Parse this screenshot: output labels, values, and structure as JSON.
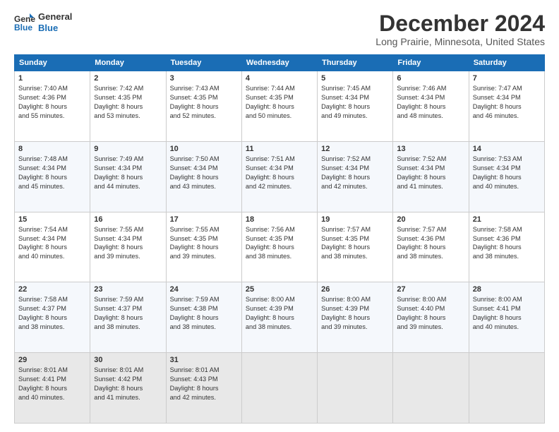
{
  "logo": {
    "line1": "General",
    "line2": "Blue"
  },
  "title": "December 2024",
  "subtitle": "Long Prairie, Minnesota, United States",
  "days_of_week": [
    "Sunday",
    "Monday",
    "Tuesday",
    "Wednesday",
    "Thursday",
    "Friday",
    "Saturday"
  ],
  "weeks": [
    [
      {
        "day": "1",
        "sunrise": "7:40 AM",
        "sunset": "4:36 PM",
        "daylight": "8 hours and 55 minutes."
      },
      {
        "day": "2",
        "sunrise": "7:42 AM",
        "sunset": "4:35 PM",
        "daylight": "8 hours and 53 minutes."
      },
      {
        "day": "3",
        "sunrise": "7:43 AM",
        "sunset": "4:35 PM",
        "daylight": "8 hours and 52 minutes."
      },
      {
        "day": "4",
        "sunrise": "7:44 AM",
        "sunset": "4:35 PM",
        "daylight": "8 hours and 50 minutes."
      },
      {
        "day": "5",
        "sunrise": "7:45 AM",
        "sunset": "4:34 PM",
        "daylight": "8 hours and 49 minutes."
      },
      {
        "day": "6",
        "sunrise": "7:46 AM",
        "sunset": "4:34 PM",
        "daylight": "8 hours and 48 minutes."
      },
      {
        "day": "7",
        "sunrise": "7:47 AM",
        "sunset": "4:34 PM",
        "daylight": "8 hours and 46 minutes."
      }
    ],
    [
      {
        "day": "8",
        "sunrise": "7:48 AM",
        "sunset": "4:34 PM",
        "daylight": "8 hours and 45 minutes."
      },
      {
        "day": "9",
        "sunrise": "7:49 AM",
        "sunset": "4:34 PM",
        "daylight": "8 hours and 44 minutes."
      },
      {
        "day": "10",
        "sunrise": "7:50 AM",
        "sunset": "4:34 PM",
        "daylight": "8 hours and 43 minutes."
      },
      {
        "day": "11",
        "sunrise": "7:51 AM",
        "sunset": "4:34 PM",
        "daylight": "8 hours and 42 minutes."
      },
      {
        "day": "12",
        "sunrise": "7:52 AM",
        "sunset": "4:34 PM",
        "daylight": "8 hours and 42 minutes."
      },
      {
        "day": "13",
        "sunrise": "7:52 AM",
        "sunset": "4:34 PM",
        "daylight": "8 hours and 41 minutes."
      },
      {
        "day": "14",
        "sunrise": "7:53 AM",
        "sunset": "4:34 PM",
        "daylight": "8 hours and 40 minutes."
      }
    ],
    [
      {
        "day": "15",
        "sunrise": "7:54 AM",
        "sunset": "4:34 PM",
        "daylight": "8 hours and 40 minutes."
      },
      {
        "day": "16",
        "sunrise": "7:55 AM",
        "sunset": "4:34 PM",
        "daylight": "8 hours and 39 minutes."
      },
      {
        "day": "17",
        "sunrise": "7:55 AM",
        "sunset": "4:35 PM",
        "daylight": "8 hours and 39 minutes."
      },
      {
        "day": "18",
        "sunrise": "7:56 AM",
        "sunset": "4:35 PM",
        "daylight": "8 hours and 38 minutes."
      },
      {
        "day": "19",
        "sunrise": "7:57 AM",
        "sunset": "4:35 PM",
        "daylight": "8 hours and 38 minutes."
      },
      {
        "day": "20",
        "sunrise": "7:57 AM",
        "sunset": "4:36 PM",
        "daylight": "8 hours and 38 minutes."
      },
      {
        "day": "21",
        "sunrise": "7:58 AM",
        "sunset": "4:36 PM",
        "daylight": "8 hours and 38 minutes."
      }
    ],
    [
      {
        "day": "22",
        "sunrise": "7:58 AM",
        "sunset": "4:37 PM",
        "daylight": "8 hours and 38 minutes."
      },
      {
        "day": "23",
        "sunrise": "7:59 AM",
        "sunset": "4:37 PM",
        "daylight": "8 hours and 38 minutes."
      },
      {
        "day": "24",
        "sunrise": "7:59 AM",
        "sunset": "4:38 PM",
        "daylight": "8 hours and 38 minutes."
      },
      {
        "day": "25",
        "sunrise": "8:00 AM",
        "sunset": "4:39 PM",
        "daylight": "8 hours and 38 minutes."
      },
      {
        "day": "26",
        "sunrise": "8:00 AM",
        "sunset": "4:39 PM",
        "daylight": "8 hours and 39 minutes."
      },
      {
        "day": "27",
        "sunrise": "8:00 AM",
        "sunset": "4:40 PM",
        "daylight": "8 hours and 39 minutes."
      },
      {
        "day": "28",
        "sunrise": "8:00 AM",
        "sunset": "4:41 PM",
        "daylight": "8 hours and 40 minutes."
      }
    ],
    [
      {
        "day": "29",
        "sunrise": "8:01 AM",
        "sunset": "4:41 PM",
        "daylight": "8 hours and 40 minutes."
      },
      {
        "day": "30",
        "sunrise": "8:01 AM",
        "sunset": "4:42 PM",
        "daylight": "8 hours and 41 minutes."
      },
      {
        "day": "31",
        "sunrise": "8:01 AM",
        "sunset": "4:43 PM",
        "daylight": "8 hours and 42 minutes."
      },
      null,
      null,
      null,
      null
    ]
  ]
}
